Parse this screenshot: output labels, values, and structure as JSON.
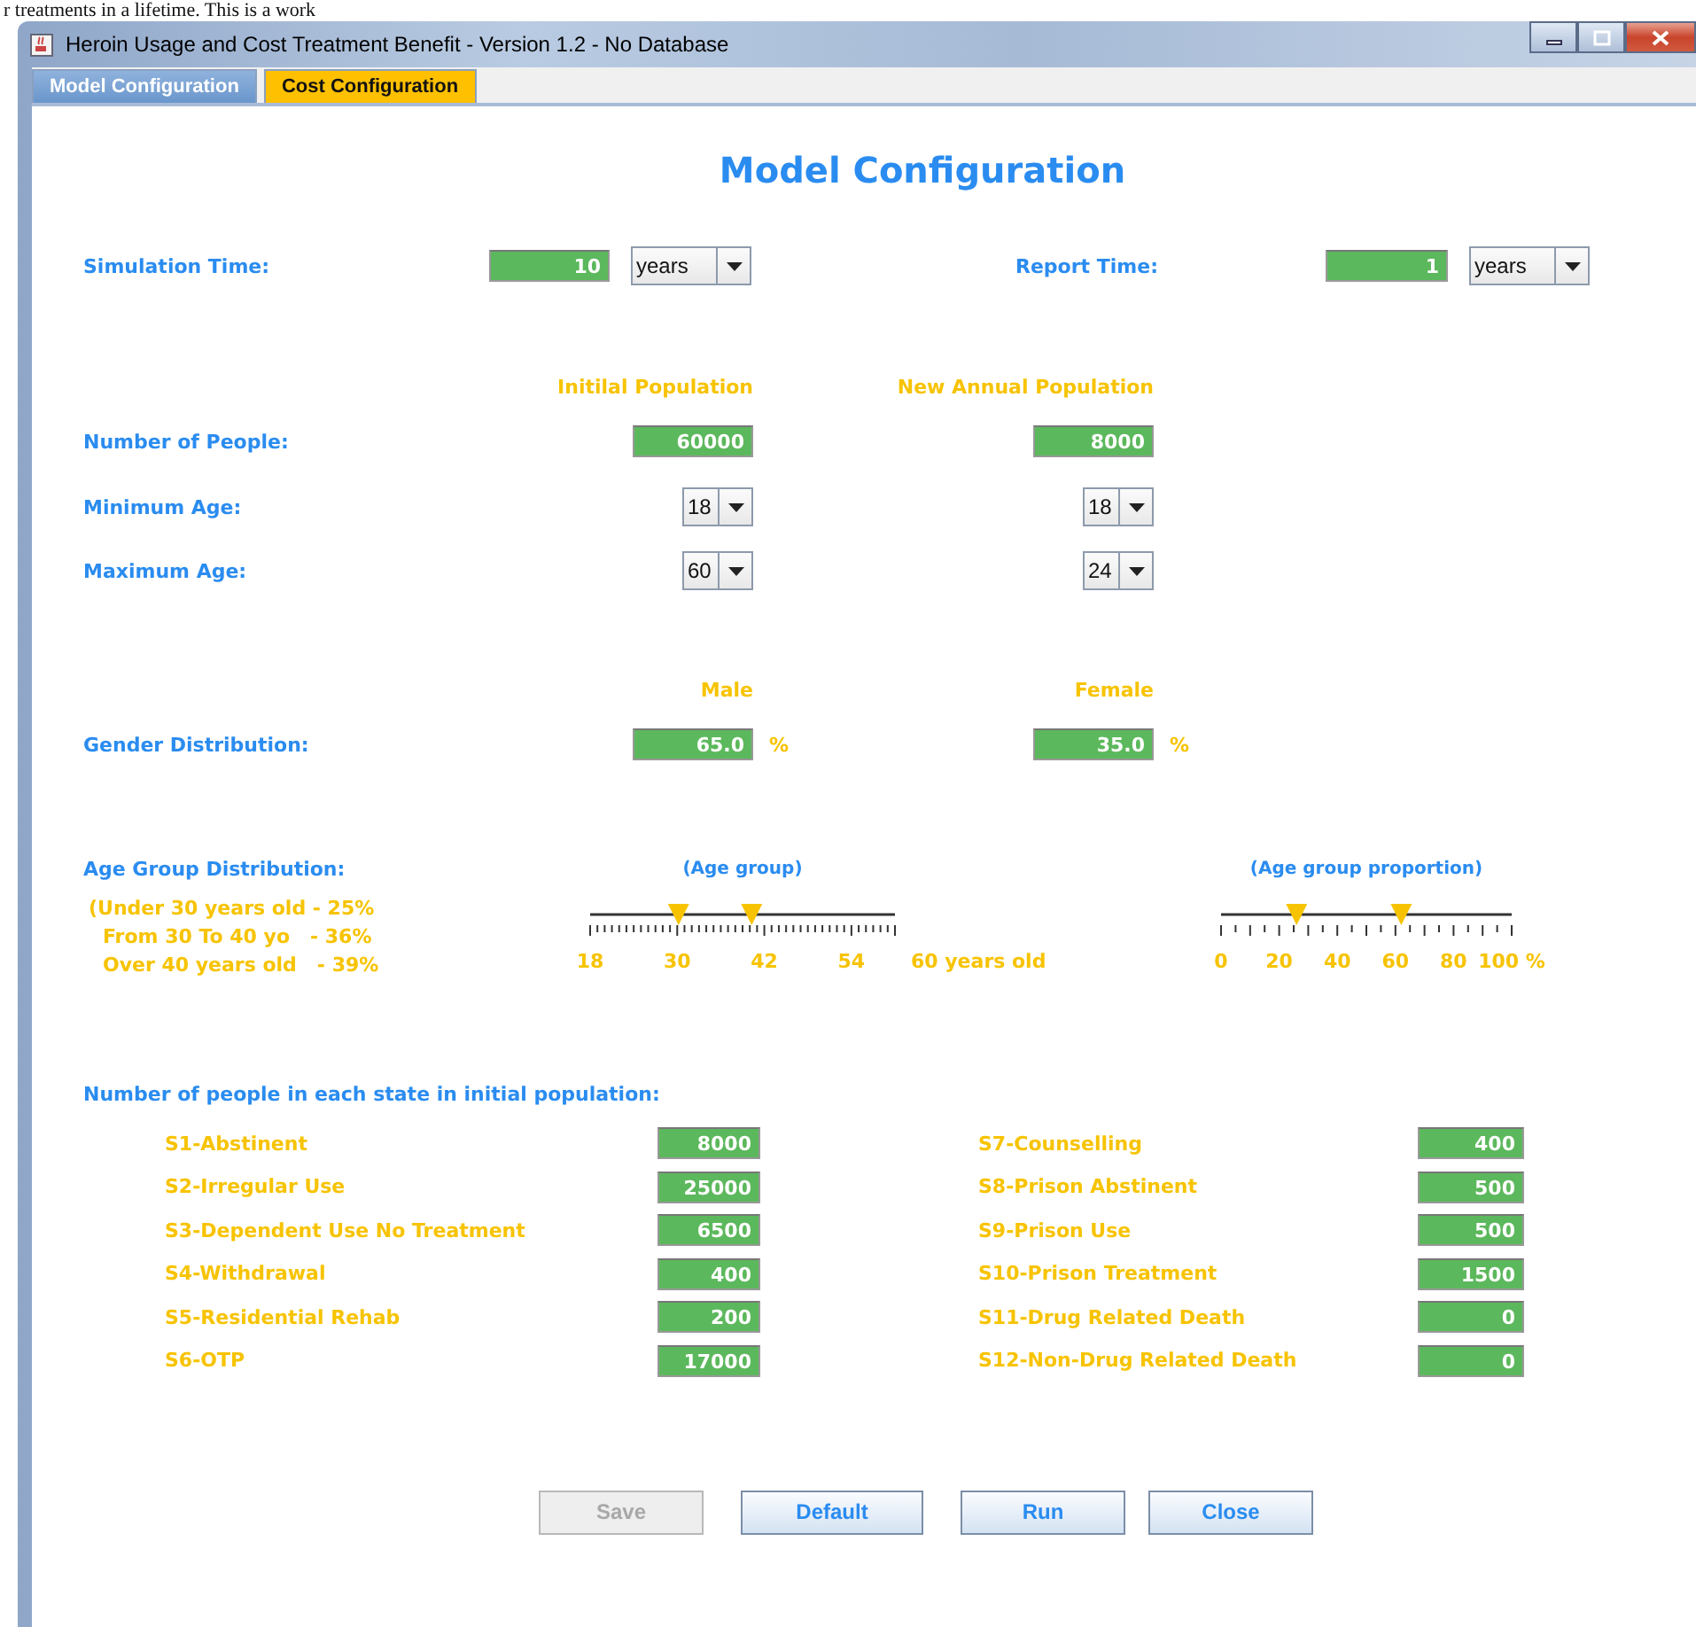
{
  "background_text": "r treatments in a lifetime. This is a work",
  "window": {
    "title": "Heroin Usage and Cost Treatment Benefit - Version 1.2 - No Database"
  },
  "tabs": [
    {
      "label": "Model Configuration",
      "selected": true
    },
    {
      "label": "Cost Configuration",
      "selected": false
    }
  ],
  "heading": "Model Configuration",
  "timing": [
    {
      "label": "Simulation Time:",
      "value": "10",
      "unit": "years"
    },
    {
      "label": "Report Time:",
      "value": "1",
      "unit": "years"
    }
  ],
  "population": {
    "columns": [
      "Initilal Population",
      "New Annual Population"
    ],
    "rows": [
      {
        "label": "Number of People:",
        "kind": "field",
        "values": [
          "60000",
          "8000"
        ]
      },
      {
        "label": "Minimum Age:",
        "kind": "dropdown",
        "values": [
          "18",
          "18"
        ]
      },
      {
        "label": "Maximum Age:",
        "kind": "dropdown",
        "values": [
          "60",
          "24"
        ]
      }
    ]
  },
  "gender": {
    "label": "Gender Distribution:",
    "columns": [
      {
        "heading": "Male",
        "value": "65.0",
        "unit": "%"
      },
      {
        "heading": "Female",
        "value": "35.0",
        "unit": "%"
      }
    ]
  },
  "age_groups": {
    "label": "Age Group Distribution:",
    "lines": [
      "(Under 30 years old - 25%",
      "From 30 To 40 yo   - 36%",
      "Over 40 years old   - 39%"
    ],
    "sliders": [
      {
        "kind": "age",
        "title": "(Age group)",
        "ticks": [
          "18",
          "30",
          "42",
          "54"
        ],
        "end_label": "60 years old",
        "thumbs": [
          {
            "level": 0.29
          },
          {
            "level": 0.53
          }
        ]
      },
      {
        "kind": "proportion",
        "title": "(Age group proportion)",
        "ticks": [
          "0",
          "20",
          "40",
          "60",
          "80",
          "100 %"
        ],
        "thumbs": [
          {
            "level": 0.26
          },
          {
            "level": 0.62
          }
        ]
      }
    ]
  },
  "states": {
    "heading": "Number of people in each state in initial population:",
    "left": [
      {
        "label": "S1-Abstinent",
        "value": "8000"
      },
      {
        "label": "S2-Irregular Use",
        "value": "25000"
      },
      {
        "label": "S3-Dependent Use No Treatment",
        "value": "6500"
      },
      {
        "label": "S4-Withdrawal",
        "value": "400"
      },
      {
        "label": "S5-Residential Rehab",
        "value": "200"
      },
      {
        "label": "S6-OTP",
        "value": "17000"
      }
    ],
    "right": [
      {
        "label": "S7-Counselling",
        "value": "400"
      },
      {
        "label": "S8-Prison Abstinent",
        "value": "500"
      },
      {
        "label": "S9-Prison Use",
        "value": "500"
      },
      {
        "label": "S10-Prison Treatment",
        "value": "1500"
      },
      {
        "label": "S11-Drug Related Death",
        "value": "0"
      },
      {
        "label": "S12-Non-Drug Related Death",
        "value": "0"
      }
    ]
  },
  "buttons": [
    {
      "label": "Save",
      "disabled": true
    },
    {
      "label": "Default",
      "disabled": false
    },
    {
      "label": "Run",
      "disabled": false
    },
    {
      "label": "Close",
      "disabled": false
    }
  ]
}
